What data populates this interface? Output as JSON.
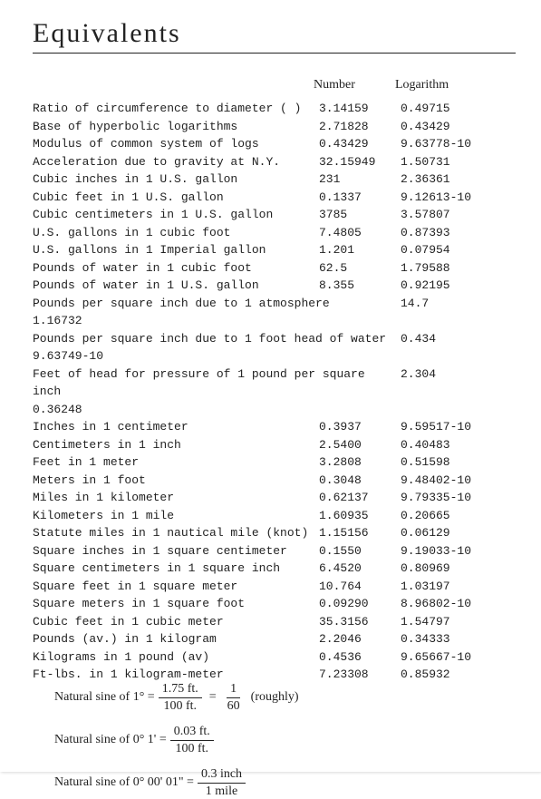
{
  "title": "Equivalents",
  "headers": {
    "number": "Number",
    "log": "Logarithm"
  },
  "rows": [
    {
      "desc": "Ratio of circumference to diameter ( )",
      "num": "3.14159",
      "log": "0.49715"
    },
    {
      "desc": "Base of hyperbolic logarithms",
      "num": "2.71828",
      "log": "0.43429"
    },
    {
      "desc": "Modulus of common system of logs",
      "num": "0.43429",
      "log": "9.63778-10"
    },
    {
      "desc": "Acceleration due to gravity at N.Y.",
      "num": "32.15949",
      "log": "1.50731"
    },
    {
      "desc": "Cubic inches in 1 U.S. gallon",
      "num": "231",
      "log": "2.36361"
    },
    {
      "desc": "Cubic feet in 1 U.S. gallon",
      "num": "0.1337",
      "log": "9.12613-10"
    },
    {
      "desc": "Cubic centimeters in 1 U.S. gallon",
      "num": "3785",
      "log": "3.57807"
    },
    {
      "desc": "U.S. gallons in 1 cubic foot",
      "num": "7.4805",
      "log": "0.87393"
    },
    {
      "desc": "U.S. gallons in 1 Imperial gallon",
      "num": "1.201",
      "log": "0.07954"
    },
    {
      "desc": "Pounds of water in 1 cubic foot",
      "num": "62.5",
      "log": "1.79588"
    },
    {
      "desc": "Pounds of water in 1 U.S. gallon",
      "num": "8.355",
      "log": "0.92195"
    }
  ],
  "longRows": [
    {
      "desc": "Pounds per square inch due to 1 atmosphere",
      "num": "14.7",
      "log": "1.16732"
    },
    {
      "desc": "Pounds per square inch due to 1 foot head of water",
      "num": "0.434",
      "log": "9.63749-10"
    },
    {
      "desc": "Feet of head for pressure of 1 pound per square inch",
      "num": "2.304",
      "log": "0.36248"
    }
  ],
  "rows2": [
    {
      "desc": "Inches in 1 centimeter",
      "num": "0.3937",
      "log": "9.59517-10"
    },
    {
      "desc": "Centimeters in 1 inch",
      "num": "2.5400",
      "log": "0.40483"
    },
    {
      "desc": "Feet in 1 meter",
      "num": "3.2808",
      "log": "0.51598"
    },
    {
      "desc": "Meters in 1 foot",
      "num": "0.3048",
      "log": "9.48402-10"
    },
    {
      "desc": "Miles in 1 kilometer",
      "num": "0.62137",
      "log": "9.79335-10"
    },
    {
      "desc": "Kilometers in 1 mile",
      "num": "1.60935",
      "log": "0.20665"
    },
    {
      "desc": "Statute miles in 1 nautical mile (knot)",
      "num": "1.15156",
      "log": "0.06129"
    },
    {
      "desc": "Square inches in 1 square centimeter",
      "num": "0.1550",
      "log": "9.19033-10"
    },
    {
      "desc": "Square centimeters in 1 square inch",
      "num": "6.4520",
      "log": "0.80969"
    },
    {
      "desc": "Square feet in 1 square meter",
      "num": "10.764",
      "log": "1.03197"
    },
    {
      "desc": "Square meters in 1 square foot",
      "num": "0.09290",
      "log": "8.96802-10"
    },
    {
      "desc": "Cubic feet in 1 cubic meter",
      "num": "35.3156",
      "log": "1.54797"
    },
    {
      "desc": "Pounds (av.) in 1 kilogram",
      "num": "2.2046",
      "log": "0.34333"
    },
    {
      "desc": "Kilograms in 1 pound (av)",
      "num": "0.4536",
      "log": "9.65667-10"
    },
    {
      "desc": "Ft-lbs. in 1 kilogram-meter",
      "num": "7.23308",
      "log": "0.85932"
    }
  ],
  "formulas": {
    "f1": {
      "label": "Natural sine of 1° =",
      "num1": "1.75 ft.",
      "den1": "100 ft.",
      "num2": "1",
      "den2": "60",
      "suffix": "(roughly)"
    },
    "f2": {
      "label": "Natural sine of 0° 1' =",
      "num": "0.03 ft.",
      "den": "100 ft."
    },
    "f3": {
      "label": "Natural sine of 0° 00' 01\" =",
      "num": "0.3 inch",
      "den": "1 mile"
    }
  }
}
